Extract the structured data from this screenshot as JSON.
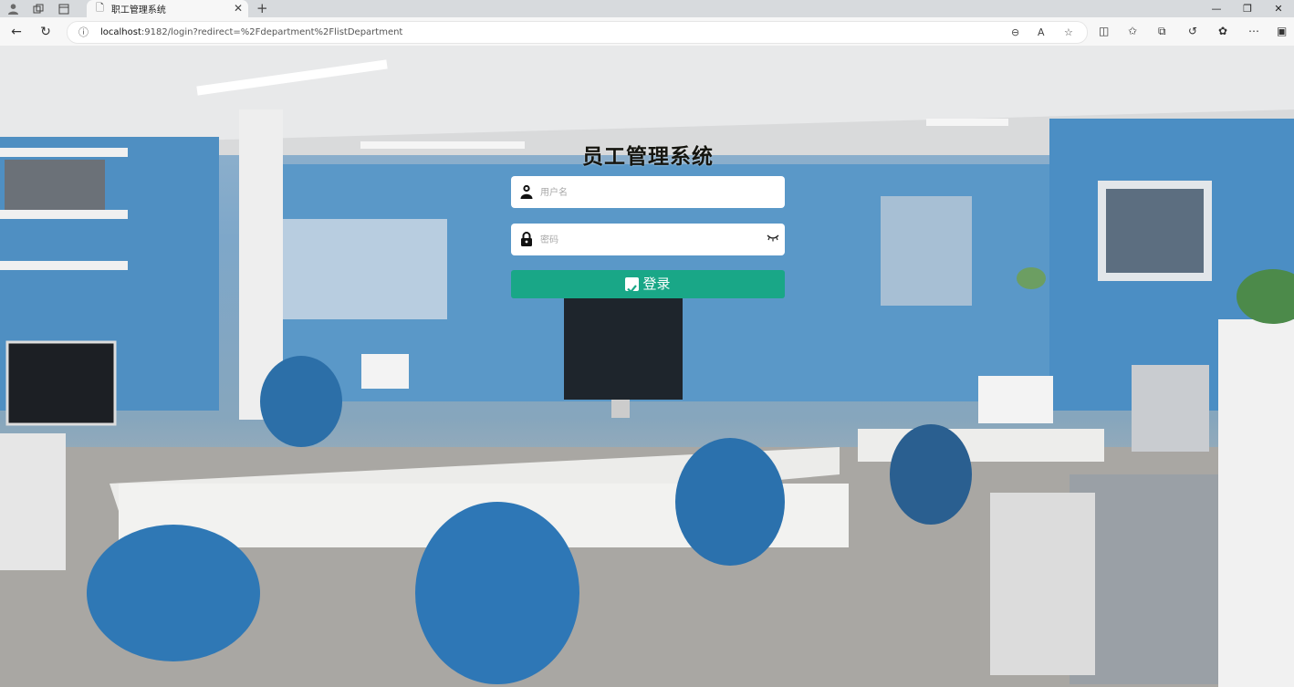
{
  "browser": {
    "tab_title": "职工管理系统",
    "url_host": "localhost",
    "url_rest": ":9182/login?redirect=%2Fdepartment%2FlistDepartment"
  },
  "login": {
    "title": "员工管理系统",
    "username_placeholder": "用户名",
    "password_placeholder": "密码",
    "submit_label": "登录"
  },
  "colors": {
    "button": "#19a787",
    "title": "#15150f",
    "wall": "#7ea7c9"
  },
  "icons": {
    "username": "user-icon",
    "password": "lock-icon",
    "visibility": "eye-closed-icon",
    "submit": "checkbox-icon"
  }
}
